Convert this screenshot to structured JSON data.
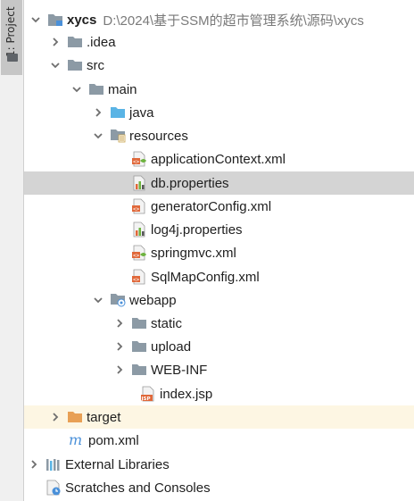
{
  "toolstrip": {
    "project_tab_label": "1: Project"
  },
  "tree": {
    "root": {
      "name": "xycs",
      "path": "D:\\2024\\基于SSM的超市管理系统\\源码\\xycs"
    },
    "idea": "idea",
    "src": "src",
    "main": "main",
    "java": "java",
    "resources": "resources",
    "files": {
      "applicationContext": "applicationContext.xml",
      "db": "db.properties",
      "generatorConfig": "generatorConfig.xml",
      "log4j": "log4j.properties",
      "springmvc": "springmvc.xml",
      "sqlMapConfig": "SqlMapConfig.xml",
      "index": "index.jsp",
      "pom": "pom.xml"
    },
    "webapp": "webapp",
    "static": "static",
    "upload": "upload",
    "webinf": "WEB-INF",
    "target": "target",
    "external": "External Libraries",
    "scratches": "Scratches and Consoles"
  },
  "colors": {
    "selected_row": "#d4d4d4",
    "excluded_row": "#fdf6e3",
    "folder_gray": "#8c9aa5",
    "folder_blue": "#5ab4e5",
    "folder_orange": "#e8a055",
    "xml_badge": "#e0683a",
    "spring_green": "#6db33f"
  }
}
